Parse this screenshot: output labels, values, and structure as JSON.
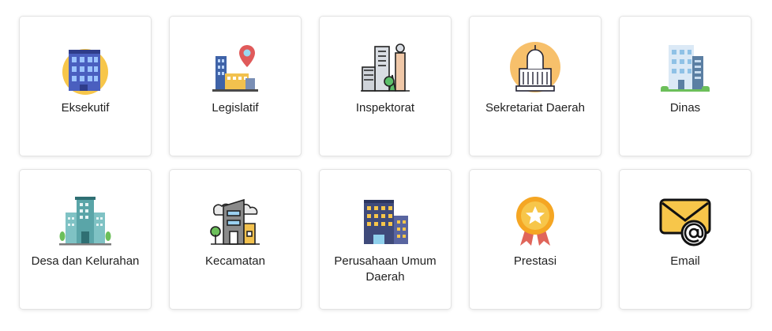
{
  "menu": [
    {
      "label": "Eksekutif",
      "icon": "government-building-icon"
    },
    {
      "label": "Legislatif",
      "icon": "city-location-pin-icon"
    },
    {
      "label": "Inspektorat",
      "icon": "city-buildings-icon"
    },
    {
      "label": "Sekretariat Daerah",
      "icon": "capitol-building-icon"
    },
    {
      "label": "Dinas",
      "icon": "office-building-icon"
    },
    {
      "label": "Desa dan Kelurahan",
      "icon": "village-office-icon"
    },
    {
      "label": "Kecamatan",
      "icon": "district-office-icon"
    },
    {
      "label": "Perusahaan Umum Daerah",
      "icon": "company-buildings-icon"
    },
    {
      "label": "Prestasi",
      "icon": "award-ribbon-icon"
    },
    {
      "label": "Email",
      "icon": "email-envelope-icon"
    }
  ]
}
